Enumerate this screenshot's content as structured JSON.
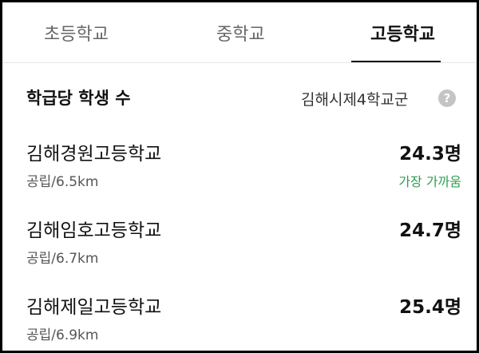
{
  "tabs": [
    {
      "label": "초등학교",
      "active": false
    },
    {
      "label": "중학교",
      "active": false
    },
    {
      "label": "고등학교",
      "active": true
    }
  ],
  "header": {
    "title": "학급당 학생 수",
    "district": "김해시제4학교군",
    "help_icon": "?"
  },
  "schools": [
    {
      "name": "김해경원고등학교",
      "meta": "공립/6.5km",
      "value": "24.3명",
      "tag": "가장 가까움"
    },
    {
      "name": "김해임호고등학교",
      "meta": "공립/6.7km",
      "value": "24.7명"
    },
    {
      "name": "김해제일고등학교",
      "meta": "공립/6.9km",
      "value": "25.4명"
    }
  ],
  "colors": {
    "accent_tag": "#2e9e50",
    "active_tab": "#111111",
    "inactive_tab": "#666666"
  }
}
